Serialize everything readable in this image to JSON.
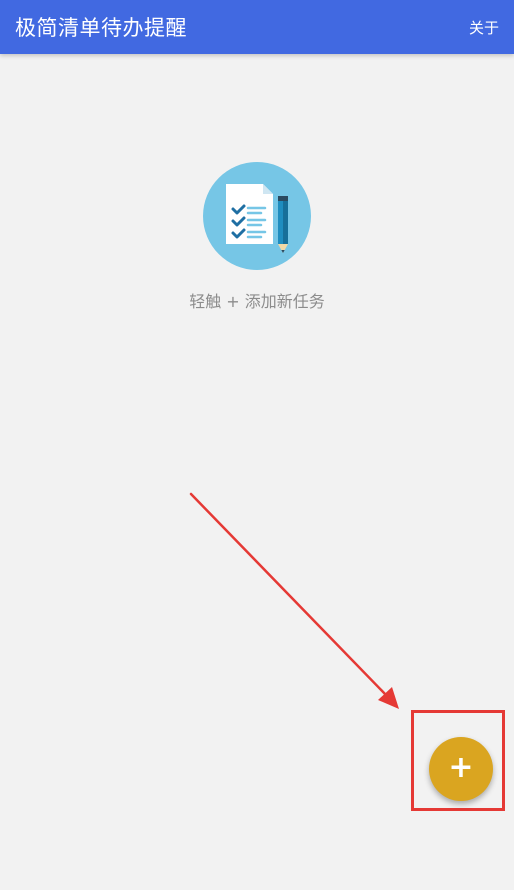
{
  "toolbar": {
    "title": "极简清单待办提醒",
    "about_label": "关于",
    "background_color": "#4169e1"
  },
  "empty_state": {
    "icon": "checklist-document-pencil-icon",
    "hint": "轻触 + 添加新任务"
  },
  "fab": {
    "label": "+",
    "icon": "plus-icon",
    "color": "#daa520"
  },
  "annotation": {
    "arrow_color": "#e53935",
    "highlight_color": "#e53935"
  }
}
